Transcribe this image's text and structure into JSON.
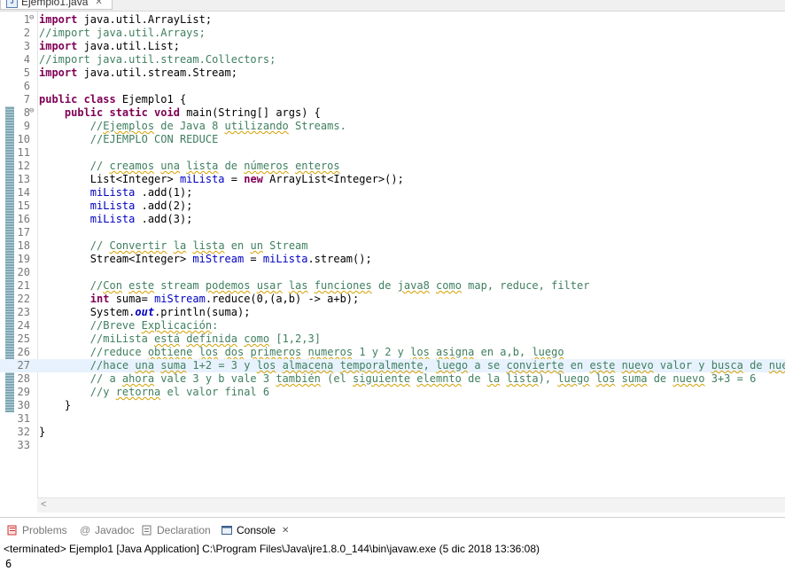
{
  "editor_tab": {
    "filename": "Ejemplo1.java"
  },
  "code_lines": [
    {
      "n": "1",
      "fold": "−",
      "segs": [
        [
          "kw",
          "import"
        ],
        [
          "",
          "java.util.ArrayList;"
        ]
      ]
    },
    {
      "n": "2",
      "segs": [
        [
          "cm",
          "//import java.util.Arrays;"
        ]
      ]
    },
    {
      "n": "3",
      "segs": [
        [
          "kw",
          "import"
        ],
        [
          "",
          "java.util.List;"
        ]
      ]
    },
    {
      "n": "4",
      "segs": [
        [
          "cm",
          "//import java.util.stream.Collectors;"
        ]
      ]
    },
    {
      "n": "5",
      "segs": [
        [
          "kw",
          "import"
        ],
        [
          "",
          "java.util.stream.Stream;"
        ]
      ]
    },
    {
      "n": "6",
      "segs": []
    },
    {
      "n": "7",
      "segs": [
        [
          "kw",
          "public class"
        ],
        [
          "",
          "Ejemplo1 {"
        ]
      ]
    },
    {
      "n": "8",
      "fold": "−",
      "segs": [
        [
          "",
          "    "
        ],
        [
          "kw",
          "public static void"
        ],
        [
          "",
          "main(String[] args) {"
        ]
      ]
    },
    {
      "n": "9",
      "segs": [
        [
          "cm",
          "        //"
        ],
        [
          "cm sq",
          "Ejemplos"
        ],
        [
          "cm",
          " de Java 8 "
        ],
        [
          "cm sq",
          "utilizando"
        ],
        [
          "cm",
          " Streams."
        ]
      ]
    },
    {
      "n": "10",
      "segs": [
        [
          "cm",
          "        //EJEMPLO CON REDUCE"
        ]
      ]
    },
    {
      "n": "11",
      "segs": []
    },
    {
      "n": "12",
      "segs": [
        [
          "cm",
          "        // "
        ],
        [
          "cm sq",
          "creamos"
        ],
        [
          "cm",
          " "
        ],
        [
          "cm sq",
          "una"
        ],
        [
          "cm",
          " "
        ],
        [
          "cm sq",
          "lista"
        ],
        [
          "cm",
          " de "
        ],
        [
          "cm sq",
          "números"
        ],
        [
          "cm",
          " "
        ],
        [
          "cm sq",
          "enteros"
        ]
      ]
    },
    {
      "n": "13",
      "segs": [
        [
          "",
          "        List<Integer> "
        ],
        [
          "fld",
          "miLista"
        ],
        [
          "",
          " = "
        ],
        [
          "kw",
          "new"
        ],
        [
          "",
          "ArrayList<Integer>();"
        ]
      ]
    },
    {
      "n": "14",
      "segs": [
        [
          "",
          "        "
        ],
        [
          "fld",
          "miLista"
        ],
        [
          "",
          " .add(1);"
        ]
      ]
    },
    {
      "n": "15",
      "segs": [
        [
          "",
          "        "
        ],
        [
          "fld",
          "miLista"
        ],
        [
          "",
          " .add(2);"
        ]
      ]
    },
    {
      "n": "16",
      "segs": [
        [
          "",
          "        "
        ],
        [
          "fld",
          "miLista"
        ],
        [
          "",
          " .add(3);"
        ]
      ]
    },
    {
      "n": "17",
      "segs": []
    },
    {
      "n": "18",
      "segs": [
        [
          "cm",
          "        // "
        ],
        [
          "cm sq",
          "Convertir"
        ],
        [
          "cm",
          " "
        ],
        [
          "cm sq",
          "la"
        ],
        [
          "cm",
          " "
        ],
        [
          "cm sq",
          "lista"
        ],
        [
          "cm",
          " en "
        ],
        [
          "cm sq",
          "un"
        ],
        [
          "cm",
          " Stream"
        ]
      ]
    },
    {
      "n": "19",
      "segs": [
        [
          "",
          "        Stream<Integer> "
        ],
        [
          "fld",
          "miStream"
        ],
        [
          "",
          " = "
        ],
        [
          "fld",
          "miLista"
        ],
        [
          "",
          ".stream();"
        ]
      ]
    },
    {
      "n": "20",
      "segs": []
    },
    {
      "n": "21",
      "segs": [
        [
          "cm",
          "        //"
        ],
        [
          "cm sq",
          "Con"
        ],
        [
          "cm",
          " "
        ],
        [
          "cm sq",
          "este"
        ],
        [
          "cm",
          " stream "
        ],
        [
          "cm sq",
          "podemos"
        ],
        [
          "cm",
          " "
        ],
        [
          "cm sq",
          "usar"
        ],
        [
          "cm",
          " "
        ],
        [
          "cm sq",
          "las"
        ],
        [
          "cm",
          " "
        ],
        [
          "cm sq",
          "funciones"
        ],
        [
          "cm",
          " de "
        ],
        [
          "cm sq",
          "java8"
        ],
        [
          "cm",
          " "
        ],
        [
          "cm sq",
          "como"
        ],
        [
          "cm",
          " map, reduce, filter"
        ]
      ]
    },
    {
      "n": "22",
      "segs": [
        [
          "",
          "        "
        ],
        [
          "kw",
          "int"
        ],
        [
          "",
          "suma= "
        ],
        [
          "fld",
          "miStream"
        ],
        [
          "",
          ".reduce(0,(a,b) -> a+b);"
        ]
      ]
    },
    {
      "n": "23",
      "segs": [
        [
          "",
          "        System."
        ],
        [
          "st",
          "out"
        ],
        [
          "",
          ".println(suma);"
        ]
      ]
    },
    {
      "n": "24",
      "segs": [
        [
          "cm",
          "        //Breve "
        ],
        [
          "cm sq",
          "Explicación"
        ],
        [
          "cm",
          ":"
        ]
      ]
    },
    {
      "n": "25",
      "segs": [
        [
          "cm",
          "        //miLista "
        ],
        [
          "cm sq",
          "está"
        ],
        [
          "cm",
          " "
        ],
        [
          "cm sq",
          "definida"
        ],
        [
          "cm",
          " "
        ],
        [
          "cm sq",
          "como"
        ],
        [
          "cm",
          " [1,2,3]"
        ]
      ]
    },
    {
      "n": "26",
      "segs": [
        [
          "cm",
          "        //reduce "
        ],
        [
          "cm sq",
          "obtiene"
        ],
        [
          "cm",
          " "
        ],
        [
          "cm sq",
          "los"
        ],
        [
          "cm",
          " "
        ],
        [
          "cm sq",
          "dos"
        ],
        [
          "cm",
          " "
        ],
        [
          "cm sq",
          "primeros"
        ],
        [
          "cm",
          " "
        ],
        [
          "cm sq",
          "numeros"
        ],
        [
          "cm",
          " 1 y 2 y "
        ],
        [
          "cm sq",
          "los"
        ],
        [
          "cm",
          " "
        ],
        [
          "cm sq",
          "asigna"
        ],
        [
          "cm",
          " en a,b, "
        ],
        [
          "cm sq",
          "luego"
        ]
      ]
    },
    {
      "n": "27",
      "current": true,
      "segs": [
        [
          "cm",
          "        //hace "
        ],
        [
          "cm sq",
          "una"
        ],
        [
          "cm",
          " "
        ],
        [
          "cm sq",
          "suma"
        ],
        [
          "cm",
          " 1+2 = 3 y "
        ],
        [
          "cm sq",
          "los"
        ],
        [
          "cm",
          " "
        ],
        [
          "cm sq",
          "almacena"
        ],
        [
          "cm",
          " "
        ],
        [
          "cm sq",
          "temporalmente"
        ],
        [
          "cm",
          ", "
        ],
        [
          "cm sq",
          "luego"
        ],
        [
          "cm",
          " a se "
        ],
        [
          "cm sq",
          "convierte"
        ],
        [
          "cm",
          " en "
        ],
        [
          "cm sq",
          "este"
        ],
        [
          "cm",
          " "
        ],
        [
          "cm sq",
          "nuevo"
        ],
        [
          "cm",
          " valor y "
        ],
        [
          "cm sq",
          "busca"
        ],
        [
          "cm",
          " de "
        ],
        [
          "cm sq",
          "nuevo"
        ]
      ]
    },
    {
      "n": "28",
      "segs": [
        [
          "cm",
          "        // a "
        ],
        [
          "cm sq",
          "ahora"
        ],
        [
          "cm",
          " vale 3 y b vale 3 "
        ],
        [
          "cm sq",
          "también"
        ],
        [
          "cm",
          " (el "
        ],
        [
          "cm sq",
          "siguiente"
        ],
        [
          "cm",
          " "
        ],
        [
          "cm sq",
          "elemnto"
        ],
        [
          "cm",
          " de "
        ],
        [
          "cm sq",
          "la"
        ],
        [
          "cm",
          " "
        ],
        [
          "cm sq",
          "lista"
        ],
        [
          "cm",
          "), "
        ],
        [
          "cm sq",
          "luego"
        ],
        [
          "cm",
          " "
        ],
        [
          "cm sq",
          "los"
        ],
        [
          "cm",
          " "
        ],
        [
          "cm sq",
          "suma"
        ],
        [
          "cm",
          " de "
        ],
        [
          "cm sq",
          "nuevo"
        ],
        [
          "cm",
          " 3+3 = 6"
        ]
      ]
    },
    {
      "n": "29",
      "segs": [
        [
          "cm",
          "        //y "
        ],
        [
          "cm sq",
          "retorna"
        ],
        [
          "cm",
          " el valor final 6"
        ]
      ]
    },
    {
      "n": "30",
      "segs": [
        [
          "",
          "    }"
        ]
      ]
    },
    {
      "n": "31",
      "segs": []
    },
    {
      "n": "32",
      "segs": [
        [
          "",
          "}"
        ]
      ]
    },
    {
      "n": "33",
      "segs": []
    }
  ],
  "bottom_panel": {
    "tabs": [
      {
        "label": "Problems",
        "icon": "problems-icon",
        "active": false
      },
      {
        "label": "Javadoc",
        "icon": "javadoc-icon",
        "active": false
      },
      {
        "label": "Declaration",
        "icon": "declaration-icon",
        "active": false
      },
      {
        "label": "Console",
        "icon": "console-icon",
        "active": true
      }
    ],
    "status": "<terminated> Ejemplo1 [Java Application] C:\\Program Files\\Java\\jre1.8.0_144\\bin\\javaw.exe (5 dic 2018 13:36:08)",
    "output": "6"
  }
}
